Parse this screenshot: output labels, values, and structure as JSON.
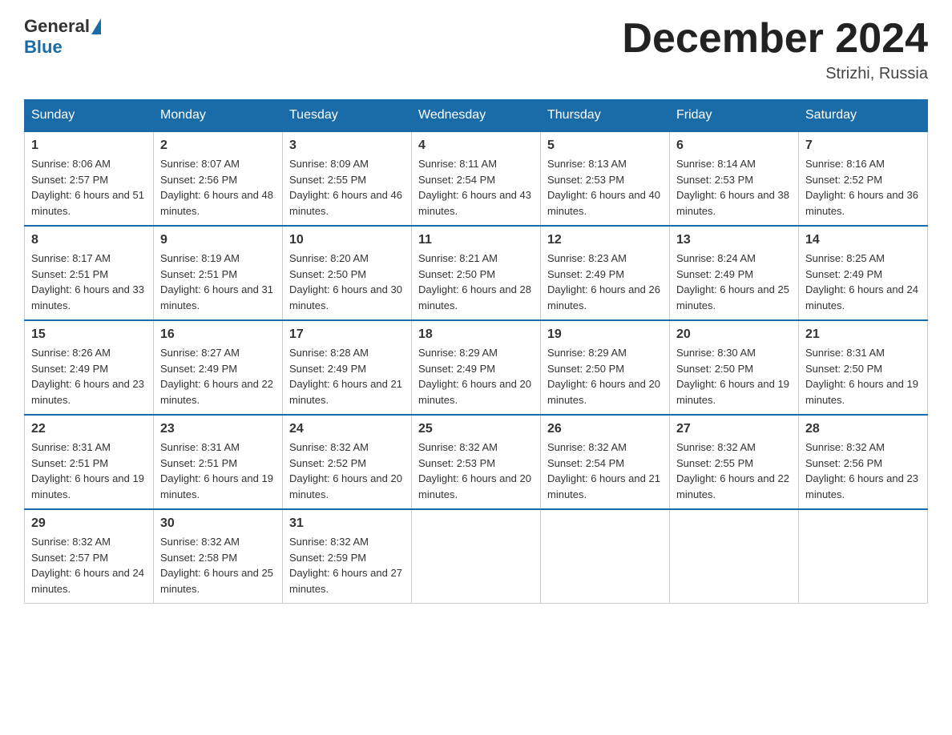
{
  "header": {
    "logo_general": "General",
    "logo_blue": "Blue",
    "month_title": "December 2024",
    "location": "Strizhi, Russia"
  },
  "days_of_week": [
    "Sunday",
    "Monday",
    "Tuesday",
    "Wednesday",
    "Thursday",
    "Friday",
    "Saturday"
  ],
  "weeks": [
    [
      {
        "day": "1",
        "sunrise": "8:06 AM",
        "sunset": "2:57 PM",
        "daylight": "6 hours and 51 minutes."
      },
      {
        "day": "2",
        "sunrise": "8:07 AM",
        "sunset": "2:56 PM",
        "daylight": "6 hours and 48 minutes."
      },
      {
        "day": "3",
        "sunrise": "8:09 AM",
        "sunset": "2:55 PM",
        "daylight": "6 hours and 46 minutes."
      },
      {
        "day": "4",
        "sunrise": "8:11 AM",
        "sunset": "2:54 PM",
        "daylight": "6 hours and 43 minutes."
      },
      {
        "day": "5",
        "sunrise": "8:13 AM",
        "sunset": "2:53 PM",
        "daylight": "6 hours and 40 minutes."
      },
      {
        "day": "6",
        "sunrise": "8:14 AM",
        "sunset": "2:53 PM",
        "daylight": "6 hours and 38 minutes."
      },
      {
        "day": "7",
        "sunrise": "8:16 AM",
        "sunset": "2:52 PM",
        "daylight": "6 hours and 36 minutes."
      }
    ],
    [
      {
        "day": "8",
        "sunrise": "8:17 AM",
        "sunset": "2:51 PM",
        "daylight": "6 hours and 33 minutes."
      },
      {
        "day": "9",
        "sunrise": "8:19 AM",
        "sunset": "2:51 PM",
        "daylight": "6 hours and 31 minutes."
      },
      {
        "day": "10",
        "sunrise": "8:20 AM",
        "sunset": "2:50 PM",
        "daylight": "6 hours and 30 minutes."
      },
      {
        "day": "11",
        "sunrise": "8:21 AM",
        "sunset": "2:50 PM",
        "daylight": "6 hours and 28 minutes."
      },
      {
        "day": "12",
        "sunrise": "8:23 AM",
        "sunset": "2:49 PM",
        "daylight": "6 hours and 26 minutes."
      },
      {
        "day": "13",
        "sunrise": "8:24 AM",
        "sunset": "2:49 PM",
        "daylight": "6 hours and 25 minutes."
      },
      {
        "day": "14",
        "sunrise": "8:25 AM",
        "sunset": "2:49 PM",
        "daylight": "6 hours and 24 minutes."
      }
    ],
    [
      {
        "day": "15",
        "sunrise": "8:26 AM",
        "sunset": "2:49 PM",
        "daylight": "6 hours and 23 minutes."
      },
      {
        "day": "16",
        "sunrise": "8:27 AM",
        "sunset": "2:49 PM",
        "daylight": "6 hours and 22 minutes."
      },
      {
        "day": "17",
        "sunrise": "8:28 AM",
        "sunset": "2:49 PM",
        "daylight": "6 hours and 21 minutes."
      },
      {
        "day": "18",
        "sunrise": "8:29 AM",
        "sunset": "2:49 PM",
        "daylight": "6 hours and 20 minutes."
      },
      {
        "day": "19",
        "sunrise": "8:29 AM",
        "sunset": "2:50 PM",
        "daylight": "6 hours and 20 minutes."
      },
      {
        "day": "20",
        "sunrise": "8:30 AM",
        "sunset": "2:50 PM",
        "daylight": "6 hours and 19 minutes."
      },
      {
        "day": "21",
        "sunrise": "8:31 AM",
        "sunset": "2:50 PM",
        "daylight": "6 hours and 19 minutes."
      }
    ],
    [
      {
        "day": "22",
        "sunrise": "8:31 AM",
        "sunset": "2:51 PM",
        "daylight": "6 hours and 19 minutes."
      },
      {
        "day": "23",
        "sunrise": "8:31 AM",
        "sunset": "2:51 PM",
        "daylight": "6 hours and 19 minutes."
      },
      {
        "day": "24",
        "sunrise": "8:32 AM",
        "sunset": "2:52 PM",
        "daylight": "6 hours and 20 minutes."
      },
      {
        "day": "25",
        "sunrise": "8:32 AM",
        "sunset": "2:53 PM",
        "daylight": "6 hours and 20 minutes."
      },
      {
        "day": "26",
        "sunrise": "8:32 AM",
        "sunset": "2:54 PM",
        "daylight": "6 hours and 21 minutes."
      },
      {
        "day": "27",
        "sunrise": "8:32 AM",
        "sunset": "2:55 PM",
        "daylight": "6 hours and 22 minutes."
      },
      {
        "day": "28",
        "sunrise": "8:32 AM",
        "sunset": "2:56 PM",
        "daylight": "6 hours and 23 minutes."
      }
    ],
    [
      {
        "day": "29",
        "sunrise": "8:32 AM",
        "sunset": "2:57 PM",
        "daylight": "6 hours and 24 minutes."
      },
      {
        "day": "30",
        "sunrise": "8:32 AM",
        "sunset": "2:58 PM",
        "daylight": "6 hours and 25 minutes."
      },
      {
        "day": "31",
        "sunrise": "8:32 AM",
        "sunset": "2:59 PM",
        "daylight": "6 hours and 27 minutes."
      },
      null,
      null,
      null,
      null
    ]
  ]
}
